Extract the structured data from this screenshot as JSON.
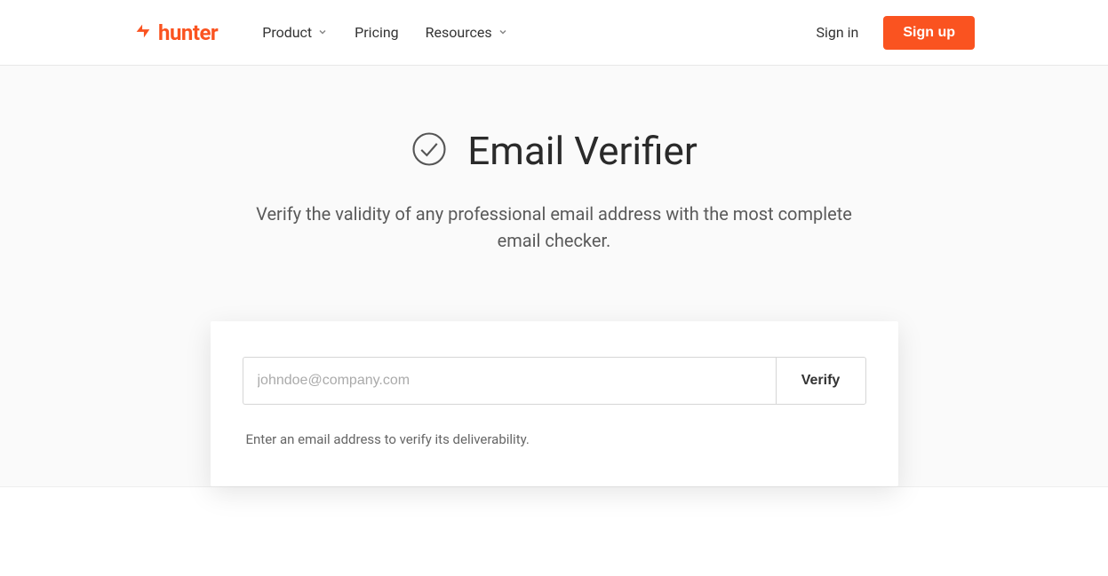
{
  "header": {
    "logo_text": "hunter",
    "nav": {
      "product": "Product",
      "pricing": "Pricing",
      "resources": "Resources"
    },
    "auth": {
      "sign_in": "Sign in",
      "sign_up": "Sign up"
    }
  },
  "hero": {
    "title": "Email Verifier",
    "subtitle": "Verify the validity of any professional email address with the most complete email checker."
  },
  "form": {
    "placeholder": "johndoe@company.com",
    "value": "",
    "verify_label": "Verify",
    "helper": "Enter an email address to verify its deliverability."
  },
  "colors": {
    "accent": "#fa5320"
  }
}
